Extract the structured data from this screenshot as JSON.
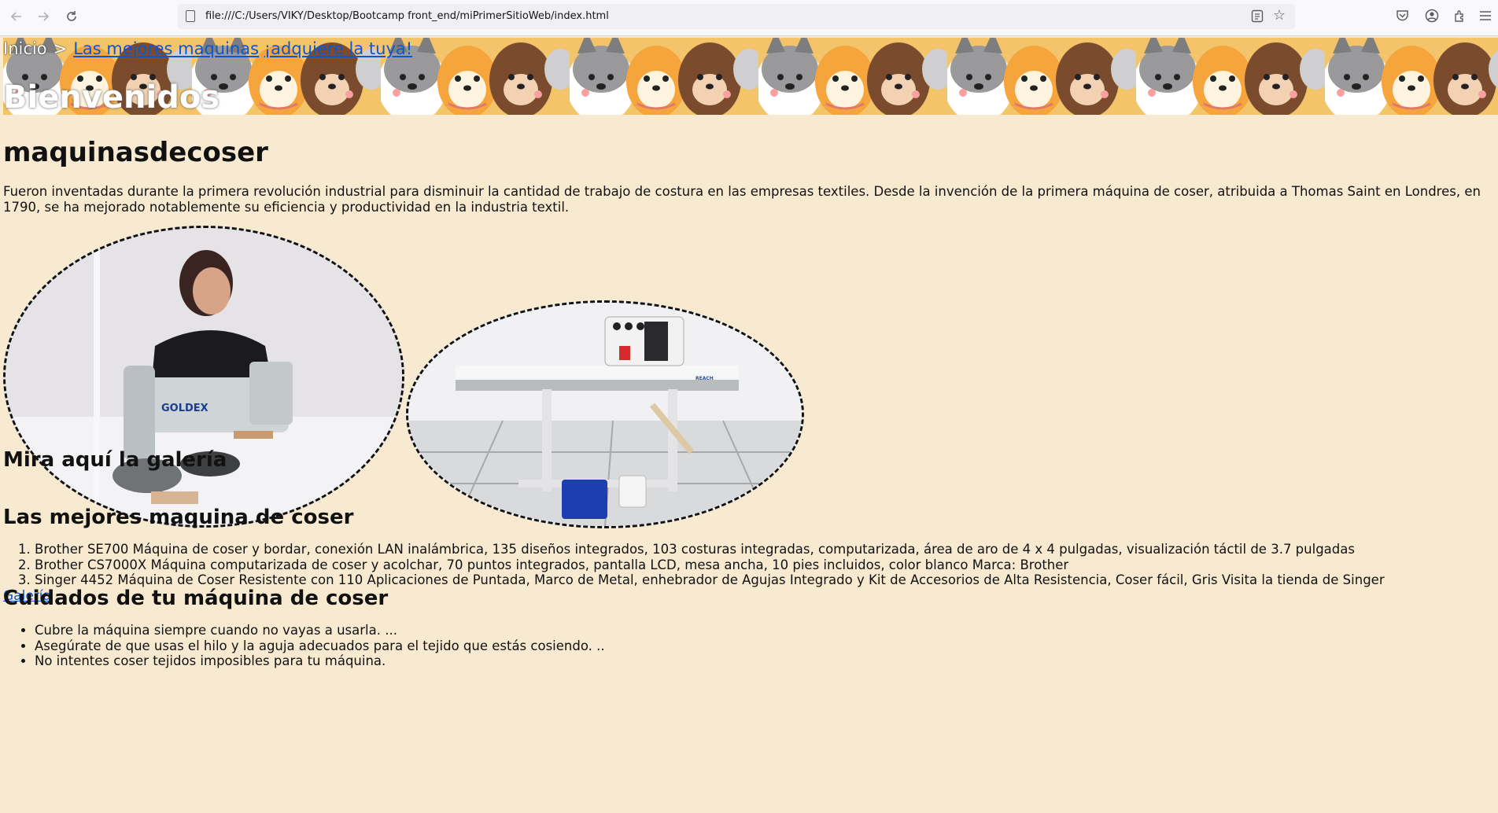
{
  "browser": {
    "url": "file:///C:/Users/VIKY/Desktop/Bootcamp front_end/miPrimerSitioWeb/index.html",
    "back_icon": "arrow-left-icon",
    "forward_icon": "arrow-right-icon",
    "reload_icon": "reload-icon"
  },
  "header": {
    "breadcrumb_home": "Inicio",
    "breadcrumb_sep": ">",
    "breadcrumb_link1": "Las mejores maquinas",
    "breadcrumb_link2": "¡adquiere la tuya!",
    "welcome": "Bienvenidos"
  },
  "main": {
    "title": "maquinasdecoser",
    "intro": "Fueron inventadas durante la primera revolución industrial para disminuir la cantidad de trabajo de costura en las empresas textiles. Desde la invención de la primera máquina de coser, atribuida a Thomas Saint en Londres, en 1790, se ha mejorado notablemente su eficiencia y productividad en la industria textil.",
    "photo1_brand": "GOLDEX",
    "photo2_brand": "REACH"
  },
  "gallery": {
    "heading": "Mira aquí la galería",
    "link": "Galería"
  },
  "best": {
    "heading": "Las mejores maquina de coser",
    "items": [
      "Brother SE700 Máquina de coser y bordar, conexión LAN inalámbrica, 135 diseños integrados, 103 costuras integradas, computarizada, área de aro de 4 x 4 pulgadas, visualización táctil de 3.7 pulgadas",
      "Brother CS7000X Máquina computarizada de coser y acolchar, 70 puntos integrados, pantalla LCD, mesa ancha, 10 pies incluidos, color blanco Marca: Brother",
      "Singer 4452 Máquina de Coser Resistente con 110 Aplicaciones de Puntada, Marco de Metal, enhebrador de Agujas Integrado y Kit de Accesorios de Alta Resistencia, Coser fácil, Gris Visita la tienda de Singer"
    ]
  },
  "care": {
    "heading": "Cuidados de tu máquina de coser",
    "items": [
      "Cubre la máquina siempre cuando no vayas a usarla. ...",
      "Asegúrate de que usas el hilo y la aguja adecuados para el tejido que estás cosiendo. ..",
      "No intentes coser tejidos imposibles para tu máquina."
    ]
  },
  "colors": {
    "page_bg": "#f8ead0",
    "link": "#0b57d0"
  }
}
